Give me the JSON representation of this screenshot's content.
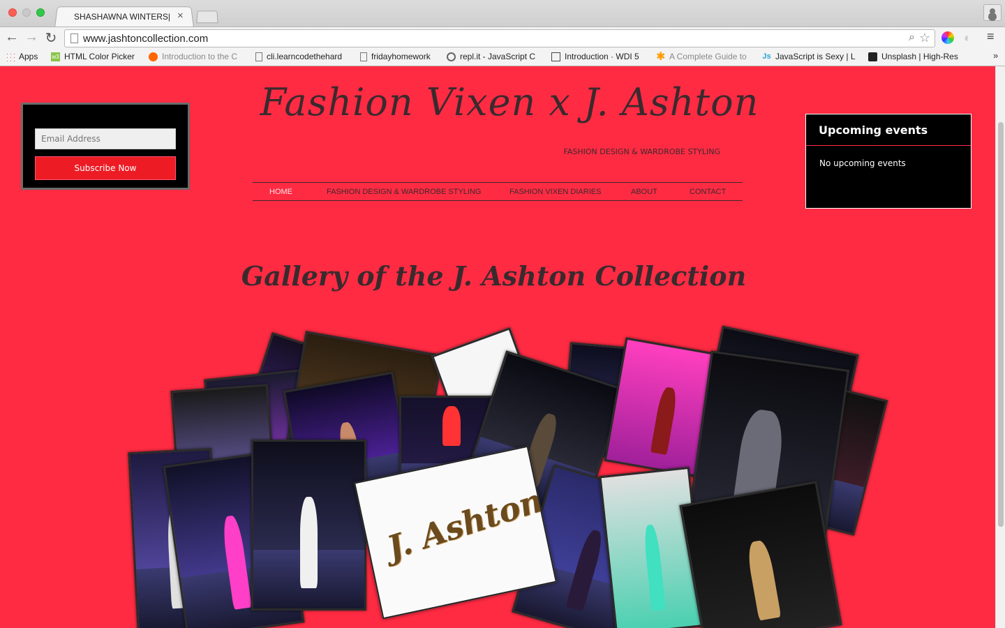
{
  "browser": {
    "tab_title": "SHASHAWNA WINTERS| J.",
    "url": "www.jashtoncollection.com",
    "bookmarks": [
      {
        "label": "Apps",
        "icon": "apps-grid-icon"
      },
      {
        "label": "HTML Color Picker",
        "icon": "w3schools-icon"
      },
      {
        "label": "Introduction to the C",
        "icon": "codecademy-icon"
      },
      {
        "label": "cli.learncodethehard",
        "icon": "page-icon"
      },
      {
        "label": "fridayhomework",
        "icon": "page-icon"
      },
      {
        "label": "repl.it - JavaScript C",
        "icon": "replit-icon"
      },
      {
        "label": "Introduction · WDI 5",
        "icon": "book-icon"
      },
      {
        "label": "A Complete Guide to",
        "icon": "css-tricks-icon"
      },
      {
        "label": "JavaScript is Sexy | L",
        "icon": "js-icon"
      },
      {
        "label": "Unsplash | High-Res",
        "icon": "camera-icon"
      }
    ]
  },
  "subscribe": {
    "email_placeholder": "Email Address",
    "button_label": "Subscribe Now"
  },
  "site": {
    "title": "Fashion Vixen x J. Ashton",
    "tagline": "FASHION DESIGN & WARDROBE STYLING"
  },
  "nav": {
    "items": [
      {
        "label": "HOME",
        "active": true
      },
      {
        "label": "FASHION DESIGN & WARDROBE STYLING",
        "active": false
      },
      {
        "label": "FASHION VIXEN DIARIES",
        "active": false
      },
      {
        "label": "ABOUT",
        "active": false
      },
      {
        "label": "CONTACT",
        "active": false
      }
    ]
  },
  "events": {
    "title": "Upcoming events",
    "empty_text": "No upcoming events"
  },
  "gallery": {
    "title": "Gallery of the J. Ashton Collection",
    "logo_text": "J. Ashton"
  },
  "colors": {
    "page_bg": "#ff2b43",
    "text_dark": "#3a2a2e",
    "subscribe_button": "#ed1c24",
    "panel_bg": "#000000"
  }
}
